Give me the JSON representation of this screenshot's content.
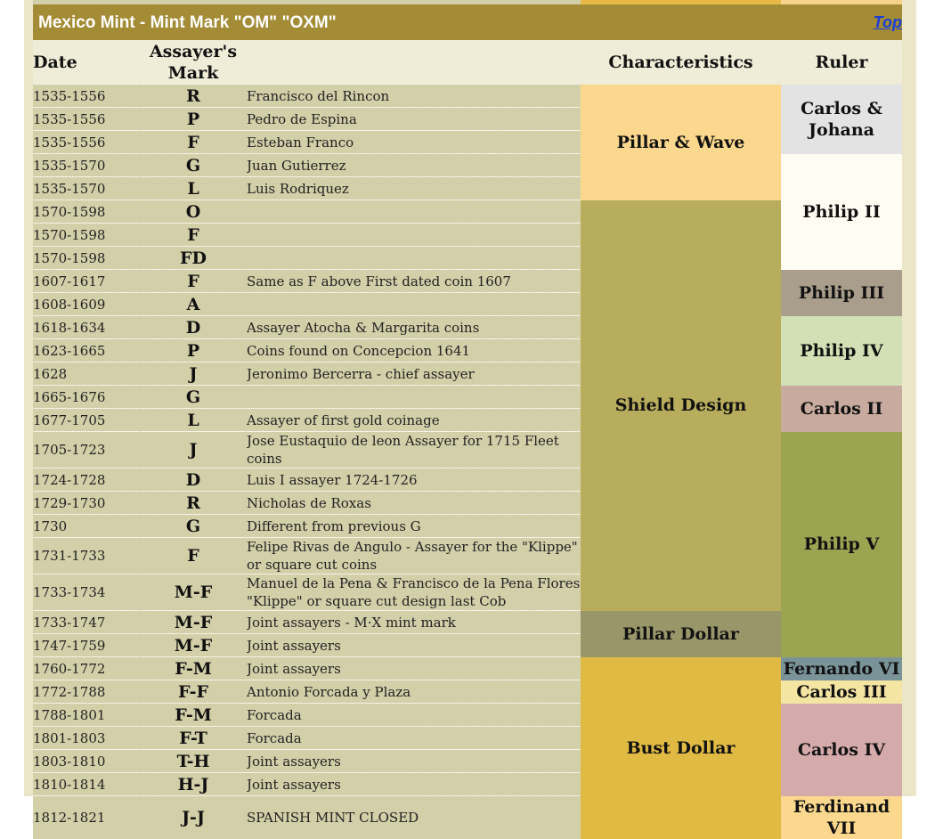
{
  "title": "Mexico Mint - Mint Mark \"OM\" \"OXM\"",
  "top_link": "Top",
  "headers": {
    "date": "Date",
    "mark": "Assayer's Mark",
    "desc": "",
    "characteristics": "Characteristics",
    "ruler": "Ruler"
  },
  "rows": [
    {
      "date": "1535-1556",
      "mark": "R",
      "desc": "Francisco del Rincon"
    },
    {
      "date": "1535-1556",
      "mark": "P",
      "desc": "Pedro de Espina"
    },
    {
      "date": "1535-1556",
      "mark": "F",
      "desc": "Esteban Franco"
    },
    {
      "date": "1535-1570",
      "mark": "G",
      "desc": "Juan Gutierrez"
    },
    {
      "date": "1535-1570",
      "mark": "L",
      "desc": "Luis Rodriquez"
    },
    {
      "date": "1570-1598",
      "mark": "O",
      "desc": ""
    },
    {
      "date": "1570-1598",
      "mark": "F",
      "desc": ""
    },
    {
      "date": "1570-1598",
      "mark": "FD",
      "desc": ""
    },
    {
      "date": "1607-1617",
      "mark": "F",
      "desc": "Same as F above First dated coin 1607"
    },
    {
      "date": "1608-1609",
      "mark": "A",
      "desc": ""
    },
    {
      "date": "1618-1634",
      "mark": "D",
      "desc": "Assayer Atocha & Margarita coins"
    },
    {
      "date": "1623-1665",
      "mark": "P",
      "desc": "Coins found on Concepcion 1641"
    },
    {
      "date": "1628",
      "mark": "J",
      "desc": "Jeronimo Bercerra - chief assayer"
    },
    {
      "date": "1665-1676",
      "mark": "G",
      "desc": ""
    },
    {
      "date": "1677-1705",
      "mark": "L",
      "desc": "Assayer of first gold coinage"
    },
    {
      "date": "1705-1723",
      "mark": "J",
      "desc": "Jose Eustaquio de leon Assayer for 1715 Fleet coins"
    },
    {
      "date": "1724-1728",
      "mark": "D",
      "desc": "Luis I assayer 1724-1726"
    },
    {
      "date": "1729-1730",
      "mark": "R",
      "desc": "Nicholas de Roxas"
    },
    {
      "date": "1730",
      "mark": "G",
      "desc": "Different from previous G"
    },
    {
      "date": "1731-1733",
      "mark": "F",
      "desc": "Felipe Rivas de Angulo - Assayer for the \"Klippe\" or square cut coins"
    },
    {
      "date": "1733-1734",
      "mark": "M-F",
      "desc": "Manuel de la Pena & Francisco de la Pena Flores \"Klippe\" or square cut design last Cob"
    },
    {
      "date": "1733-1747",
      "mark": "M-F",
      "desc": "Joint assayers - M·X mint mark"
    },
    {
      "date": "1747-1759",
      "mark": "M-F",
      "desc": "Joint assayers"
    },
    {
      "date": "1760-1772",
      "mark": "F-M",
      "desc": "Joint assayers"
    },
    {
      "date": "1772-1788",
      "mark": "F-F",
      "desc": "Antonio Forcada y Plaza"
    },
    {
      "date": "1788-1801",
      "mark": "F-M",
      "desc": "Forcada"
    },
    {
      "date": "1801-1803",
      "mark": "F-T",
      "desc": "Forcada"
    },
    {
      "date": "1803-1810",
      "mark": "T-H",
      "desc": "Joint assayers"
    },
    {
      "date": "1810-1814",
      "mark": "H-J",
      "desc": "Joint assayers"
    },
    {
      "date": "1812-1821",
      "mark": "J-J",
      "desc": "SPANISH MINT CLOSED"
    }
  ],
  "characteristics": [
    {
      "label": "Pillar & Wave",
      "color": "#fcd88e"
    },
    {
      "label": "Shield Design",
      "color": "#b7ad5c"
    },
    {
      "label": "Pillar Dollar",
      "color": "#99966a"
    },
    {
      "label": "Bust Dollar",
      "color": "#e1ba43"
    }
  ],
  "rulers": [
    {
      "label": "Carlos & Johana",
      "color": "#e3e3e3"
    },
    {
      "label": "Philip II",
      "color": "#fffdf3"
    },
    {
      "label": "Philip III",
      "color": "#a99e8b"
    },
    {
      "label": "Philip IV",
      "color": "#d3dfb4"
    },
    {
      "label": "Carlos II",
      "color": "#c8aa9e"
    },
    {
      "label": "Philip V",
      "color": "#9ba451"
    },
    {
      "label": "Fernando VI",
      "color": "#799399"
    },
    {
      "label": "Carlos III",
      "color": "#f4e5a3"
    },
    {
      "label": "Carlos IV",
      "color": "#d5aaaa"
    },
    {
      "label": "Ferdinand VII",
      "color": "#fcd88e"
    }
  ]
}
